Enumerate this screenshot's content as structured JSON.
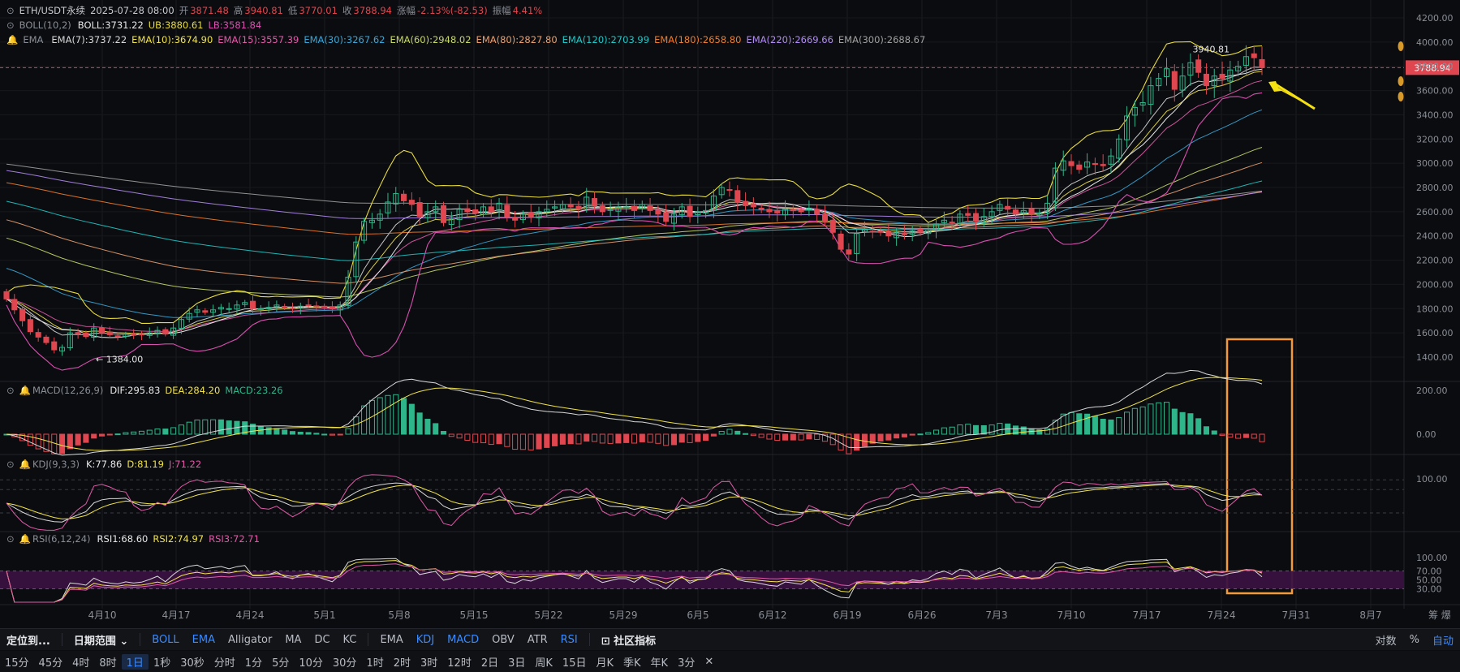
{
  "header": {
    "symbol": "ETH/USDT永续",
    "datetime": "2025-07-28 08:00",
    "open_label": "开",
    "open": "3871.48",
    "high_label": "高",
    "high": "3940.81",
    "low_label": "低",
    "low": "3770.01",
    "close_label": "收",
    "close": "3788.94",
    "change_label": "涨幅",
    "change": "-2.13%(-82.53)",
    "amp_label": "振幅",
    "amp": "4.41%"
  },
  "boll": {
    "name": "BOLL(10,2)",
    "boll": "BOLL:3731.22",
    "ub": "UB:3880.61",
    "lb": "LB:3581.84"
  },
  "ema": {
    "name": "EMA",
    "items": [
      {
        "text": "EMA(7):3737.22",
        "color": "#d8d8d8"
      },
      {
        "text": "EMA(10):3674.90",
        "color": "#f0e24a"
      },
      {
        "text": "EMA(15):3557.39",
        "color": "#e05aa8"
      },
      {
        "text": "EMA(30):3267.62",
        "color": "#3aa6d8"
      },
      {
        "text": "EMA(60):2948.02",
        "color": "#c8d86a"
      },
      {
        "text": "EMA(80):2827.80",
        "color": "#e8a070"
      },
      {
        "text": "EMA(120):2703.99",
        "color": "#21c7c7"
      },
      {
        "text": "EMA(180):2658.80",
        "color": "#f07c2c"
      },
      {
        "text": "EMA(220):2669.66",
        "color": "#b08cf0"
      },
      {
        "text": "EMA(300):2688.67",
        "color": "#a0a0a0"
      }
    ]
  },
  "macd": {
    "name": "MACD(12,26,9)",
    "dif": "DIF:295.83",
    "dea": "DEA:284.20",
    "macd": "MACD:23.26"
  },
  "kdj": {
    "name": "KDJ(9,3,3)",
    "k": "K:77.86",
    "d": "D:81.19",
    "j": "J:71.22"
  },
  "rsi": {
    "name": "RSI(6,12,24)",
    "rsi1": "RSI1:68.60",
    "rsi2": "RSI2:74.97",
    "rsi3": "RSI3:72.71"
  },
  "annotations": {
    "high_marker": "3940.81",
    "low_marker": "1384.00",
    "last_price": "3788.94"
  },
  "colors": {
    "up": "#2fb58a",
    "down": "#e0464f",
    "accent": "#3b8bff",
    "highlight_box": "#f39a3c",
    "arrow": "#f5e012"
  },
  "chart_data": {
    "type": "candlestick",
    "x_ticks": [
      "4月10",
      "4月17",
      "4月24",
      "5月1",
      "5月8",
      "5月15",
      "5月22",
      "5月29",
      "6月5",
      "6月12",
      "6月19",
      "6月26",
      "7月3",
      "7月10",
      "7月17",
      "7月24",
      "7月31",
      "8月7"
    ],
    "y_ticks": [
      "4200.00",
      "4000.00",
      "3800.00",
      "3600.00",
      "3400.00",
      "3200.00",
      "3000.00",
      "2800.00",
      "2600.00",
      "2400.00",
      "2200.00",
      "2000.00",
      "1800.00",
      "1600.00",
      "1400.00"
    ],
    "ylim": [
      1320,
      4240
    ],
    "macd_ticks": [
      "200.00",
      "0.00"
    ],
    "kdj_ticks": [
      "100.00"
    ],
    "rsi_ticks": [
      "100.00",
      "70.00",
      "50.00",
      "30.00"
    ],
    "start_date": "2025-04-05",
    "close": [
      1880,
      1790,
      1700,
      1610,
      1565,
      1520,
      1460,
      1480,
      1600,
      1590,
      1570,
      1640,
      1600,
      1585,
      1575,
      1590,
      1580,
      1585,
      1600,
      1620,
      1590,
      1640,
      1710,
      1760,
      1790,
      1770,
      1790,
      1810,
      1800,
      1830,
      1850,
      1800,
      1800,
      1810,
      1830,
      1810,
      1800,
      1820,
      1830,
      1820,
      1810,
      1800,
      1830,
      2060,
      2350,
      2520,
      2530,
      2580,
      2680,
      2750,
      2690,
      2660,
      2560,
      2600,
      2640,
      2510,
      2540,
      2620,
      2600,
      2590,
      2640,
      2600,
      2670,
      2560,
      2530,
      2580,
      2560,
      2600,
      2620,
      2640,
      2660,
      2640,
      2620,
      2720,
      2650,
      2600,
      2620,
      2640,
      2640,
      2610,
      2660,
      2610,
      2580,
      2520,
      2580,
      2640,
      2560,
      2600,
      2610,
      2730,
      2800,
      2780,
      2680,
      2650,
      2640,
      2620,
      2600,
      2590,
      2620,
      2610,
      2600,
      2630,
      2580,
      2520,
      2430,
      2290,
      2250,
      2420,
      2450,
      2440,
      2430,
      2400,
      2430,
      2410,
      2440,
      2430,
      2450,
      2500,
      2530,
      2510,
      2580,
      2570,
      2520,
      2560,
      2600,
      2660,
      2620,
      2580,
      2610,
      2580,
      2590,
      2670,
      2960,
      3020,
      2980,
      2950,
      3010,
      2990,
      2980,
      3060,
      3200,
      3390,
      3460,
      3500,
      3640,
      3700,
      3780,
      3610,
      3720,
      3830,
      3750,
      3640,
      3720,
      3700,
      3770,
      3800,
      3880,
      3871,
      3789
    ],
    "rsi_band": [
      30,
      70
    ]
  }
}
